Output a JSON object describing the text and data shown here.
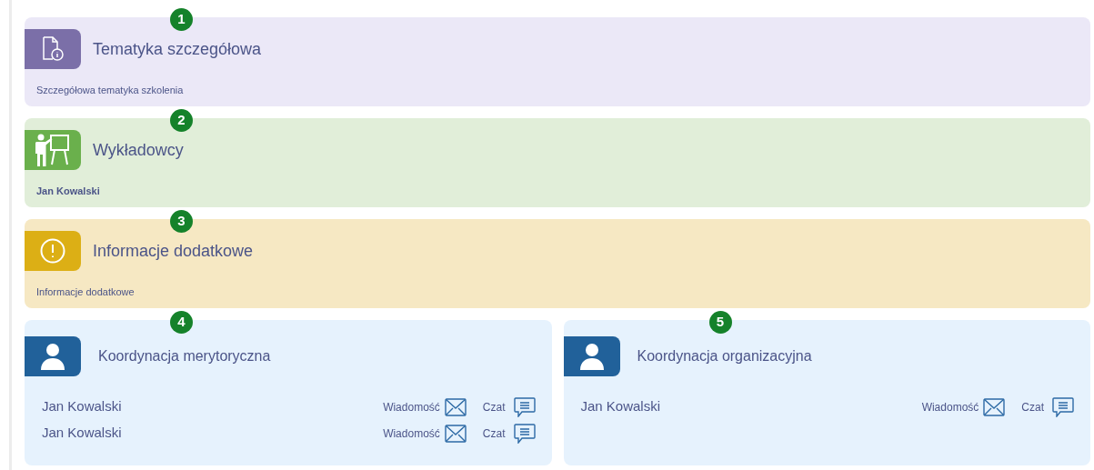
{
  "sections": [
    {
      "badge": "1",
      "kind": "topic",
      "color": "#7b6fa8",
      "title": "Tematyka szczegółowa",
      "body": "Szczegółowa tematyka szkolenia",
      "bold": false
    },
    {
      "badge": "2",
      "kind": "lecturers",
      "color": "#6ab04c",
      "title": "Wykładowcy",
      "body": "Jan Kowalski",
      "bold": true
    },
    {
      "badge": "3",
      "kind": "info",
      "color": "#dcaf15",
      "title": "Informacje dodatkowe",
      "body": "Informacje dodatkowe",
      "bold": false
    }
  ],
  "contacts": [
    {
      "badge": "4",
      "title": "Koordynacja merytoryczna",
      "people": [
        {
          "name": "Jan Kowalski",
          "message": "Wiadomość",
          "chat": "Czat"
        },
        {
          "name": "Jan Kowalski",
          "message": "Wiadomość",
          "chat": "Czat"
        }
      ]
    },
    {
      "badge": "5",
      "title": "Koordynacja organizacyjna",
      "people": [
        {
          "name": "Jan Kowalski",
          "message": "Wiadomość",
          "chat": "Czat"
        }
      ]
    }
  ]
}
